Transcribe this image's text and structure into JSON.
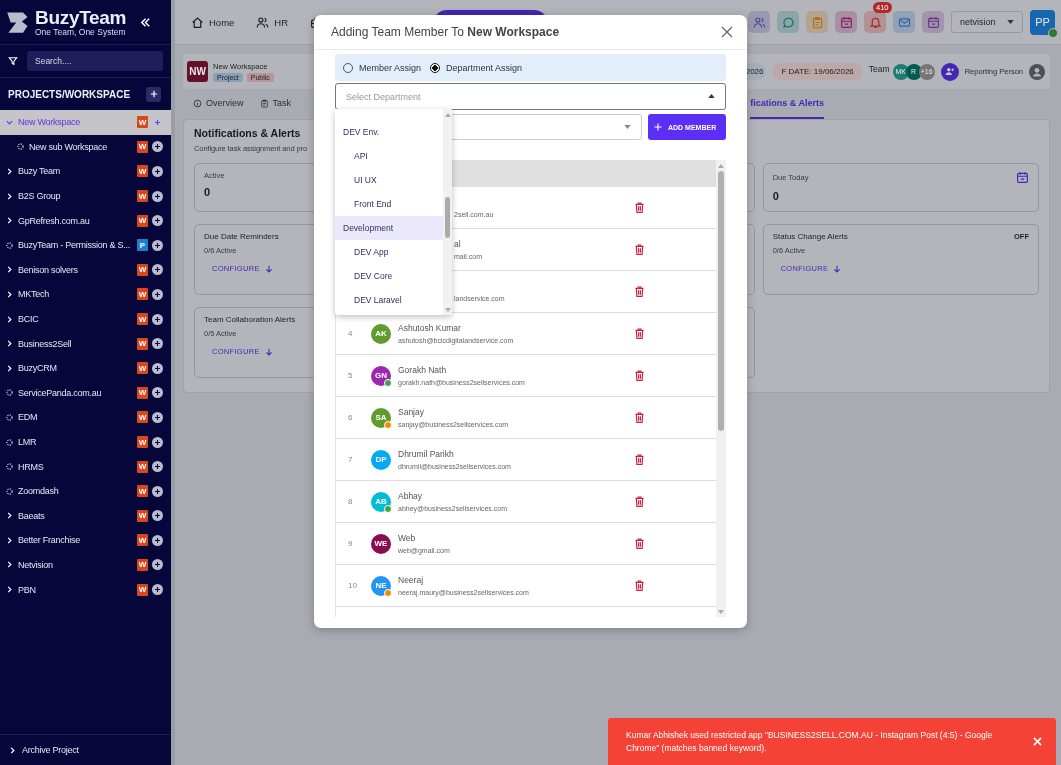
{
  "sidebar": {
    "logo_title": "BuzyTeam",
    "logo_tagline": "One Team, One System",
    "search": {
      "placeholder": "Search...."
    },
    "section_title": "PROJECTS/WORKSPACE",
    "items": [
      {
        "label": "New Workspace",
        "kind": "group",
        "expanded": true,
        "selected": true,
        "badge": {
          "text": "W",
          "color": "#d9481c"
        },
        "children": [
          {
            "label": "New sub Workspace",
            "kind": "loading",
            "selected": false,
            "badge": {
              "text": "W",
              "color": "#d9481c"
            }
          }
        ]
      },
      {
        "label": "Buzy Team",
        "kind": "group",
        "expanded": false,
        "selected": false,
        "badge": {
          "text": "W",
          "color": "#d9481c"
        }
      },
      {
        "label": "B2S Group",
        "kind": "group",
        "expanded": false,
        "selected": false,
        "badge": {
          "text": "W",
          "color": "#d9481c"
        }
      },
      {
        "label": "GpRefresh.com.au",
        "kind": "group",
        "expanded": false,
        "selected": false,
        "badge": {
          "text": "W",
          "color": "#d9481c"
        }
      },
      {
        "label": "BuzyTeam - Permission & S...",
        "kind": "loading",
        "selected": false,
        "badge": {
          "text": "P",
          "color": "#1e7fd0"
        }
      },
      {
        "label": "Benison solvers",
        "kind": "group",
        "expanded": false,
        "selected": false,
        "badge": {
          "text": "W",
          "color": "#d9481c"
        }
      },
      {
        "label": "MKTech",
        "kind": "group",
        "expanded": false,
        "selected": false,
        "badge": {
          "text": "W",
          "color": "#d9481c"
        }
      },
      {
        "label": "BCIC",
        "kind": "group",
        "expanded": false,
        "selected": false,
        "badge": {
          "text": "W",
          "color": "#d9481c"
        }
      },
      {
        "label": "Business2Sell",
        "kind": "group",
        "expanded": false,
        "selected": false,
        "badge": {
          "text": "W",
          "color": "#d9481c"
        }
      },
      {
        "label": "BuzyCRM",
        "kind": "group",
        "expanded": false,
        "selected": false,
        "badge": {
          "text": "W",
          "color": "#d9481c"
        }
      },
      {
        "label": "ServicePanda.com.au",
        "kind": "loading",
        "selected": false,
        "badge": {
          "text": "W",
          "color": "#d9481c"
        }
      },
      {
        "label": "EDM",
        "kind": "loading",
        "selected": false,
        "badge": {
          "text": "W",
          "color": "#d9481c"
        }
      },
      {
        "label": "LMR",
        "kind": "loading",
        "selected": false,
        "badge": {
          "text": "W",
          "color": "#d9481c"
        }
      },
      {
        "label": "HRMS",
        "kind": "loading",
        "selected": false,
        "badge": {
          "text": "W",
          "color": "#d9481c"
        }
      },
      {
        "label": "Zoomdash",
        "kind": "loading",
        "selected": false,
        "badge": {
          "text": "W",
          "color": "#d9481c"
        }
      },
      {
        "label": "Baeats",
        "kind": "group",
        "expanded": false,
        "selected": false,
        "badge": {
          "text": "W",
          "color": "#d9481c"
        }
      },
      {
        "label": "Better Franchise",
        "kind": "group",
        "expanded": false,
        "selected": false,
        "badge": {
          "text": "W",
          "color": "#d9481c"
        }
      },
      {
        "label": "Netvision",
        "kind": "group",
        "expanded": false,
        "selected": false,
        "badge": {
          "text": "W",
          "color": "#d9481c"
        }
      },
      {
        "label": "PBN",
        "kind": "group",
        "expanded": false,
        "selected": false,
        "badge": {
          "text": "W",
          "color": "#d9481c"
        }
      }
    ],
    "footer": "Archive Project"
  },
  "topbar": {
    "nav": [
      {
        "label": "Home",
        "kind": "home"
      },
      {
        "label": "HR",
        "kind": "people"
      },
      {
        "kind": "briefcase"
      }
    ],
    "tools": [
      {
        "kind": "people",
        "color": "#4e4696"
      },
      {
        "kind": "chat",
        "color": "#16766a"
      },
      {
        "kind": "clipboard",
        "color": "#b07018"
      },
      {
        "kind": "calendar",
        "color": "#86205e"
      },
      {
        "kind": "bell",
        "color": "#b02a28",
        "badge": "410"
      },
      {
        "kind": "mail",
        "color": "#2c68a6"
      },
      {
        "kind": "calendar",
        "color": "#6a3484"
      }
    ],
    "workspace_select": "netvision",
    "user": {
      "initials": "PP",
      "online": true
    }
  },
  "header": {
    "project": {
      "initials": "NW",
      "name": "New Workspace",
      "tags": [
        {
          "text": "Project",
          "color": "#8aa0b6"
        },
        {
          "text": "Public",
          "color": "#b9939a"
        }
      ]
    },
    "dates": [
      {
        "text": "2026",
        "color": "#a4aeba"
      },
      {
        "text": "F DATE: 19/06/2026",
        "color": "#bca8a8"
      }
    ],
    "team_label": "Team",
    "team": [
      {
        "initials": "MK",
        "color": "#1d7c74"
      },
      {
        "initials": "R",
        "color": "#005a50"
      },
      {
        "initials": "+16",
        "color": "#767676"
      }
    ],
    "reporting_label": "Reporting Person",
    "tabs": [
      {
        "label": "Overview",
        "kind": "info",
        "selected": false
      },
      {
        "label": "Task",
        "kind": "clipboard",
        "selected": false
      },
      {
        "label": "fications & Alerts",
        "kind": "plain",
        "selected": true
      }
    ]
  },
  "content": {
    "title": "Notifications & Alerts",
    "subtitle": "Configure task assignment and pro",
    "stats": [
      {
        "label": "Active",
        "value": "0",
        "kind": "plain"
      },
      {
        "label": "Due Today",
        "value": "0",
        "kind": "calendar"
      }
    ],
    "alerts": [
      {
        "title": "Due Date Reminders",
        "count": "0/6 Active",
        "action": "CONFIGURE"
      },
      {
        "title": "Status Change Alerts",
        "state": "OFF",
        "count": "0/6 Active",
        "action": "CONFIGURE"
      },
      {
        "title": "Team Collaboration Alerts",
        "count": "0/5 Active",
        "action": "CONFIGURE"
      }
    ]
  },
  "modal": {
    "title": "Adding Team Member To **New Workspace**",
    "assign_modes": [
      {
        "label": "Member Assign",
        "selected": false
      },
      {
        "label": "Department Assign",
        "selected": true
      }
    ],
    "department_select": {
      "placeholder": "Select Department",
      "expanded": true
    },
    "departments": [
      {
        "label": "DEV Env.",
        "highlighted": false,
        "children": [
          {
            "label": "API",
            "highlighted": false
          },
          {
            "label": "UI UX",
            "highlighted": false
          },
          {
            "label": "Front End",
            "highlighted": false
          }
        ]
      },
      {
        "label": "Development",
        "highlighted": true,
        "children": [
          {
            "label": "DEV App",
            "highlighted": false
          },
          {
            "label": "DEV Core",
            "highlighted": false
          },
          {
            "label": "DEV Laravel",
            "highlighted": false
          }
        ]
      }
    ],
    "add_button": "ADD MEMBER",
    "members": [
      {
        "kind": "partial",
        "email": "2sell.com.au"
      },
      {
        "kind": "partial",
        "name": "al",
        "email": "mail.com"
      },
      {
        "kind": "partial",
        "email": "landservice.com"
      },
      {
        "kind": "full",
        "number": "4",
        "initials": "AK",
        "color": "#5e9c2d",
        "online": false,
        "away": false,
        "name": "Ashutosh Kumar",
        "email": "ashutosh@bcicdigitalandservice.com"
      },
      {
        "kind": "full",
        "number": "5",
        "initials": "GN",
        "color": "#9c27b0",
        "online": true,
        "away": false,
        "name": "Gorakh Nath",
        "email": "gorakh.nath@business2sellservices.com"
      },
      {
        "kind": "full",
        "number": "6",
        "initials": "SA",
        "color": "#5e9c2d",
        "online": false,
        "away": true,
        "name": "Sanjay",
        "email": "sanjay@business2sellservices.com"
      },
      {
        "kind": "full",
        "number": "7",
        "initials": "DP",
        "color": "#03a9f4",
        "online": false,
        "away": false,
        "name": "Dhrumil Parikh",
        "email": "dhrumil@business2sellservices.com"
      },
      {
        "kind": "full",
        "number": "8",
        "initials": "AB",
        "color": "#00bcd4",
        "online": true,
        "away": false,
        "name": "Abhay",
        "email": "abhey@business2sellservices.com"
      },
      {
        "kind": "full",
        "number": "9",
        "initials": "WE",
        "color": "#880e4f",
        "online": false,
        "away": false,
        "name": "Web",
        "email": "web@gmail.com"
      },
      {
        "kind": "full",
        "number": "10",
        "initials": "NE",
        "color": "#2196f3",
        "online": false,
        "away": true,
        "name": "Neeraj",
        "email": "neeraj.maury@business2sellservices.com"
      }
    ]
  },
  "toast": {
    "message": "Kumar Abhishek used restricted app \"BUSINESS2SELL.COM.AU - Instagram Post (4:5) - Google Chrome\" (matches banned keyword)."
  }
}
